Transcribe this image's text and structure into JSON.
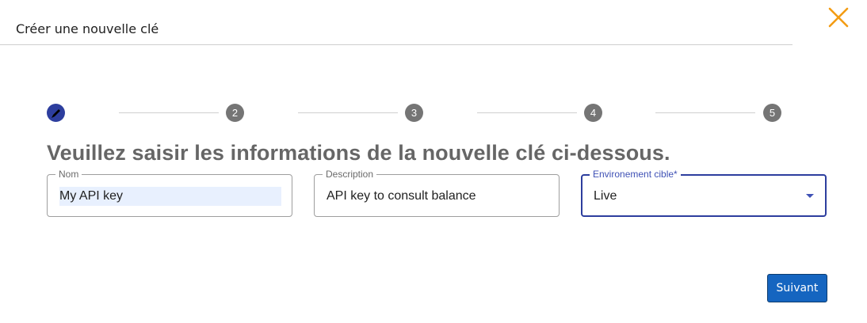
{
  "dialog": {
    "title": "Créer une nouvelle clé",
    "close_icon": "close-icon",
    "accent_color": "#f39c12"
  },
  "stepper": {
    "active_step_icon": "edit-pencil-icon",
    "steps": [
      "",
      "2",
      "3",
      "4",
      "5"
    ],
    "active_color": "#2d3e9e",
    "inactive_color": "#757575"
  },
  "form": {
    "heading": "Veuillez saisir les informations de la nouvelle clé ci-dessous.",
    "name_field": {
      "label": "Nom",
      "value": "My API key"
    },
    "description_field": {
      "label": "Description",
      "value": "API key to consult balance"
    },
    "environment_field": {
      "label": "Environement cible*",
      "value": "Live"
    }
  },
  "actions": {
    "next_label": "Suivant",
    "next_color": "#1565c0"
  }
}
